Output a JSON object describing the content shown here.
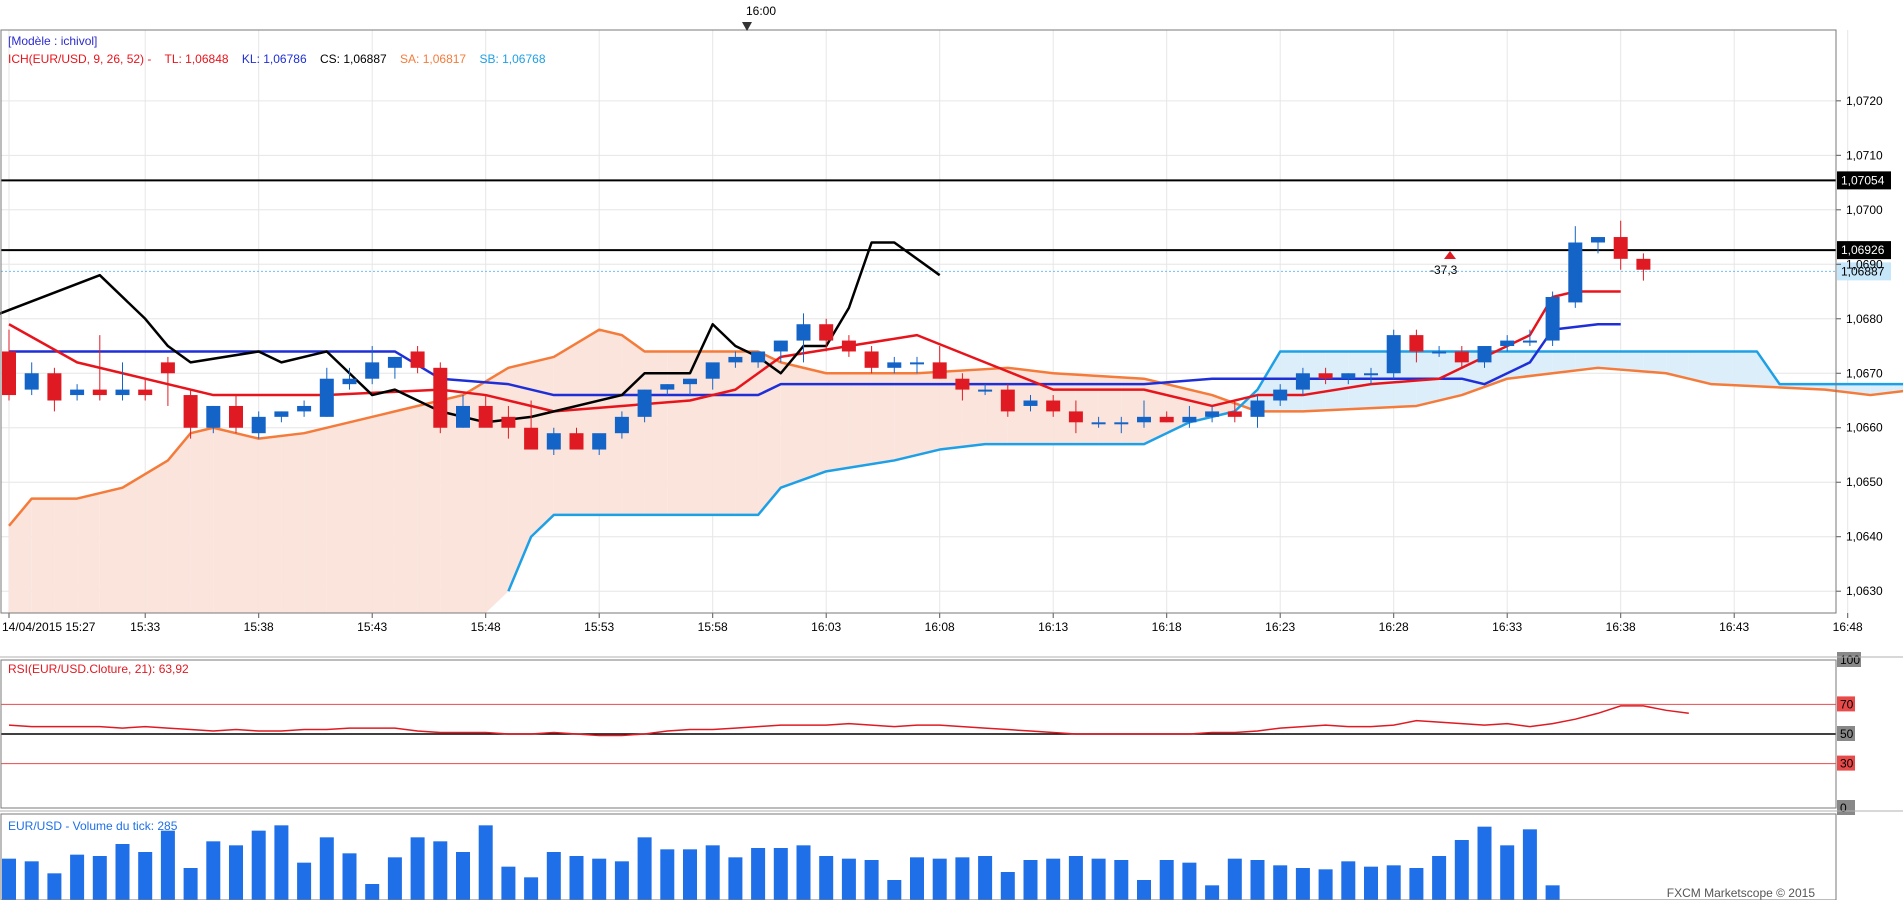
{
  "top_marker": "16:00",
  "model_label": "[Modèle : ichivol]",
  "ichimoku_legend": [
    {
      "text": "ICH(EUR/USD, 9, 26, 52) -",
      "color": "#e8141c"
    },
    {
      "text": "TL: 1,06848",
      "color": "#e8141c"
    },
    {
      "text": "KL: 1,06786",
      "color": "#1f2fd8"
    },
    {
      "text": "CS: 1,06887",
      "color": "#000000"
    },
    {
      "text": "SA: 1,06817",
      "color": "#f47b3a"
    },
    {
      "text": "SB: 1,06768",
      "color": "#1ea0e6"
    }
  ],
  "annotation": "-37,3",
  "rsi_label": "RSI(EUR/USD.Cloture, 21): 63,92",
  "volume_label": "EUR/USD - Volume du tick: 285",
  "footer": "FXCM Marketscope © 2015",
  "colors": {
    "bull": "#1464c8",
    "bear": "#e01a22",
    "tenkan": "#e8141c",
    "kijun": "#1f2fd8",
    "chikou": "#000000",
    "senkou_a": "#f47b3a",
    "senkou_b": "#1ea0e6",
    "cloud_bull": "#dceef9",
    "cloud_bear": "#fbe4dc",
    "volume": "#1e6fe8"
  },
  "chart_data": [
    {
      "type": "candlestick",
      "title": "ICH(EUR/USD, 9, 26, 52)",
      "ylim": [
        1.0626,
        1.0733
      ],
      "y_ticks": [
        "1,0630",
        "1,0640",
        "1,0650",
        "1,0660",
        "1,0670",
        "1,0680",
        "1,0690",
        "1,0700",
        "1,0710",
        "1,0720"
      ],
      "x_ticks": [
        "14/04/2015 15:27",
        "15:33",
        "15:38",
        "15:43",
        "15:48",
        "15:53",
        "15:58",
        "16:03",
        "16:08",
        "16:13",
        "16:18",
        "16:23",
        "16:28",
        "16:33",
        "16:38",
        "16:43",
        "16:48"
      ],
      "horizontal_lines": [
        {
          "value": 1.07054,
          "label": "1,07054"
        },
        {
          "value": 1.06926,
          "label": "1,06926"
        }
      ],
      "price_line": {
        "value": 1.06887,
        "label": "1,06887"
      },
      "candles": [
        [
          1.0674,
          1.0678,
          1.0665,
          1.0666
        ],
        [
          1.0667,
          1.0672,
          1.0666,
          1.067
        ],
        [
          1.067,
          1.0671,
          1.0663,
          1.0665
        ],
        [
          1.0666,
          1.0668,
          1.0665,
          1.0667
        ],
        [
          1.0667,
          1.0677,
          1.0665,
          1.0666
        ],
        [
          1.0666,
          1.0672,
          1.0665,
          1.0667
        ],
        [
          1.0667,
          1.0669,
          1.0665,
          1.0666
        ],
        [
          1.0672,
          1.0673,
          1.0664,
          1.067
        ],
        [
          1.0666,
          1.0667,
          1.0658,
          1.066
        ],
        [
          1.066,
          1.0664,
          1.0659,
          1.0664
        ],
        [
          1.0664,
          1.0666,
          1.0659,
          1.066
        ],
        [
          1.0659,
          1.0663,
          1.0658,
          1.0662
        ],
        [
          1.0662,
          1.0663,
          1.0661,
          1.0663
        ],
        [
          1.0663,
          1.0665,
          1.0662,
          1.0664
        ],
        [
          1.0662,
          1.0671,
          1.0662,
          1.0669
        ],
        [
          1.0668,
          1.0671,
          1.0667,
          1.0669
        ],
        [
          1.0669,
          1.0675,
          1.0668,
          1.0672
        ],
        [
          1.0671,
          1.0673,
          1.0669,
          1.0673
        ],
        [
          1.0674,
          1.0675,
          1.067,
          1.0671
        ],
        [
          1.0671,
          1.0672,
          1.0659,
          1.066
        ],
        [
          1.066,
          1.0666,
          1.066,
          1.0664
        ],
        [
          1.0664,
          1.0666,
          1.0661,
          1.066
        ],
        [
          1.0662,
          1.0664,
          1.0658,
          1.066
        ],
        [
          1.066,
          1.0665,
          1.0658,
          1.0656
        ],
        [
          1.0656,
          1.066,
          1.0655,
          1.0659
        ],
        [
          1.0659,
          1.066,
          1.0656,
          1.0656
        ],
        [
          1.0656,
          1.0657,
          1.0655,
          1.0659
        ],
        [
          1.0659,
          1.0663,
          1.0658,
          1.0662
        ],
        [
          1.0662,
          1.0667,
          1.0661,
          1.0667
        ],
        [
          1.0667,
          1.0668,
          1.0666,
          1.0668
        ],
        [
          1.0668,
          1.0669,
          1.0666,
          1.0669
        ],
        [
          1.0669,
          1.067,
          1.0667,
          1.0672
        ],
        [
          1.0672,
          1.0674,
          1.0671,
          1.0673
        ],
        [
          1.0672,
          1.0674,
          1.0671,
          1.0674
        ],
        [
          1.0674,
          1.0676,
          1.0672,
          1.0676
        ],
        [
          1.0676,
          1.0681,
          1.0672,
          1.0679
        ],
        [
          1.0679,
          1.068,
          1.0674,
          1.0676
        ],
        [
          1.0676,
          1.0677,
          1.0673,
          1.0674
        ],
        [
          1.0674,
          1.0675,
          1.067,
          1.0671
        ],
        [
          1.0671,
          1.0673,
          1.067,
          1.0672
        ],
        [
          1.0672,
          1.0673,
          1.067,
          1.0672
        ],
        [
          1.0672,
          1.0675,
          1.0669,
          1.0669
        ],
        [
          1.0669,
          1.067,
          1.0665,
          1.0667
        ],
        [
          1.0667,
          1.0668,
          1.0666,
          1.0667
        ],
        [
          1.0667,
          1.0668,
          1.0662,
          1.0663
        ],
        [
          1.0664,
          1.0666,
          1.0663,
          1.0665
        ],
        [
          1.0665,
          1.0666,
          1.0662,
          1.0663
        ],
        [
          1.0663,
          1.0665,
          1.0659,
          1.0661
        ],
        [
          1.0661,
          1.0662,
          1.066,
          1.0661
        ],
        [
          1.0661,
          1.0662,
          1.0659,
          1.0661
        ],
        [
          1.0661,
          1.0665,
          1.066,
          1.0662
        ],
        [
          1.0662,
          1.0663,
          1.0661,
          1.0661
        ],
        [
          1.0661,
          1.0664,
          1.066,
          1.0662
        ],
        [
          1.0662,
          1.0664,
          1.0661,
          1.0663
        ],
        [
          1.0663,
          1.0665,
          1.0661,
          1.0662
        ],
        [
          1.0662,
          1.0666,
          1.066,
          1.0665
        ],
        [
          1.0665,
          1.0668,
          1.0664,
          1.0667
        ],
        [
          1.0667,
          1.0671,
          1.0666,
          1.067
        ],
        [
          1.067,
          1.0671,
          1.0668,
          1.0669
        ],
        [
          1.0669,
          1.067,
          1.0668,
          1.067
        ],
        [
          1.067,
          1.0671,
          1.0668,
          1.067
        ],
        [
          1.067,
          1.0678,
          1.0669,
          1.0677
        ],
        [
          1.0677,
          1.0678,
          1.0672,
          1.0674
        ],
        [
          1.0674,
          1.0675,
          1.0673,
          1.0674
        ],
        [
          1.0674,
          1.0675,
          1.0671,
          1.0672
        ],
        [
          1.0672,
          1.0675,
          1.0671,
          1.0675
        ],
        [
          1.0675,
          1.0677,
          1.0674,
          1.0676
        ],
        [
          1.0676,
          1.0678,
          1.0675,
          1.0676
        ],
        [
          1.0676,
          1.0685,
          1.0675,
          1.0684
        ],
        [
          1.0683,
          1.0697,
          1.0682,
          1.0694
        ],
        [
          1.0694,
          1.0695,
          1.0692,
          1.0695
        ],
        [
          1.0695,
          1.0698,
          1.0689,
          1.0691
        ],
        [
          1.0691,
          1.0692,
          1.0687,
          1.0689
        ]
      ],
      "tenkan": [
        [
          0,
          1.0679
        ],
        [
          3,
          1.0672
        ],
        [
          6,
          1.0669
        ],
        [
          9,
          1.0666
        ],
        [
          14,
          1.0666
        ],
        [
          19,
          1.0667
        ],
        [
          21,
          1.0666
        ],
        [
          24,
          1.0663
        ],
        [
          27,
          1.0664
        ],
        [
          30,
          1.0665
        ],
        [
          32,
          1.0667
        ],
        [
          34,
          1.0673
        ],
        [
          37,
          1.0675
        ],
        [
          40,
          1.0677
        ],
        [
          43,
          1.0672
        ],
        [
          46,
          1.0667
        ],
        [
          50,
          1.0667
        ],
        [
          53,
          1.0664
        ],
        [
          55,
          1.0666
        ],
        [
          57,
          1.0666
        ],
        [
          60,
          1.0668
        ],
        [
          63,
          1.0669
        ],
        [
          65,
          1.0673
        ],
        [
          67,
          1.0677
        ],
        [
          68,
          1.0684
        ],
        [
          69,
          1.0685
        ],
        [
          71,
          1.0685
        ]
      ],
      "kijun": [
        [
          0,
          1.0674
        ],
        [
          10,
          1.0674
        ],
        [
          17,
          1.0674
        ],
        [
          19,
          1.0669
        ],
        [
          22,
          1.0668
        ],
        [
          24,
          1.0666
        ],
        [
          33,
          1.0666
        ],
        [
          34,
          1.0668
        ],
        [
          46,
          1.0668
        ],
        [
          50,
          1.0668
        ],
        [
          53,
          1.0669
        ],
        [
          64,
          1.0669
        ],
        [
          65,
          1.0668
        ],
        [
          67,
          1.0672
        ],
        [
          68,
          1.0678
        ],
        [
          70,
          1.0679
        ],
        [
          71,
          1.0679
        ]
      ],
      "chikou": [
        [
          -1,
          1.068
        ],
        [
          4,
          1.0688
        ],
        [
          6,
          1.068
        ],
        [
          7,
          1.0675
        ],
        [
          8,
          1.0672
        ],
        [
          11,
          1.0674
        ],
        [
          12,
          1.0672
        ],
        [
          14,
          1.0674
        ],
        [
          15,
          1.067
        ],
        [
          16,
          1.0666
        ],
        [
          17,
          1.0667
        ],
        [
          18,
          1.0665
        ],
        [
          19,
          1.0663
        ],
        [
          21,
          1.0661
        ],
        [
          23,
          1.0662
        ],
        [
          27,
          1.0666
        ],
        [
          28,
          1.067
        ],
        [
          30,
          1.067
        ],
        [
          31,
          1.0679
        ],
        [
          32,
          1.0675
        ],
        [
          33,
          1.0673
        ],
        [
          34,
          1.067
        ],
        [
          35,
          1.0675
        ],
        [
          36,
          1.0675
        ],
        [
          37,
          1.0682
        ],
        [
          38,
          1.0694
        ],
        [
          39,
          1.0694
        ],
        [
          41,
          1.0688
        ]
      ],
      "senkou_a": [
        [
          0,
          1.0642
        ],
        [
          1,
          1.0647
        ],
        [
          3,
          1.0647
        ],
        [
          5,
          1.0649
        ],
        [
          7,
          1.0654
        ],
        [
          8,
          1.0659
        ],
        [
          9,
          1.066
        ],
        [
          11,
          1.0658
        ],
        [
          13,
          1.0659
        ],
        [
          17,
          1.0663
        ],
        [
          20,
          1.0666
        ],
        [
          22,
          1.0671
        ],
        [
          24,
          1.0673
        ],
        [
          26,
          1.0678
        ],
        [
          27,
          1.0677
        ],
        [
          28,
          1.0674
        ],
        [
          30,
          1.0674
        ],
        [
          33,
          1.0674
        ],
        [
          34,
          1.0672
        ],
        [
          36,
          1.067
        ],
        [
          40,
          1.067
        ],
        [
          44,
          1.0671
        ],
        [
          46,
          1.067
        ],
        [
          50,
          1.0669
        ],
        [
          53,
          1.0666
        ],
        [
          55,
          1.0663
        ],
        [
          57,
          1.0663
        ],
        [
          62,
          1.0664
        ],
        [
          64,
          1.0666
        ],
        [
          66,
          1.0669
        ],
        [
          68,
          1.067
        ],
        [
          70,
          1.0671
        ],
        [
          73,
          1.067
        ],
        [
          74,
          1.0669
        ],
        [
          75,
          1.0668
        ],
        [
          80,
          1.0667
        ],
        [
          82,
          1.0666
        ],
        [
          84,
          1.0667
        ],
        [
          88,
          1.0667
        ],
        [
          89,
          1.0669
        ]
      ],
      "senkou_b": [
        [
          22,
          1.063
        ],
        [
          23,
          1.064
        ],
        [
          24,
          1.0644
        ],
        [
          33,
          1.0644
        ],
        [
          34,
          1.0649
        ],
        [
          36,
          1.0652
        ],
        [
          39,
          1.0654
        ],
        [
          41,
          1.0656
        ],
        [
          43,
          1.0657
        ],
        [
          50,
          1.0657
        ],
        [
          52,
          1.0661
        ],
        [
          54,
          1.0663
        ],
        [
          55,
          1.0667
        ],
        [
          56,
          1.0674
        ],
        [
          77,
          1.0674
        ],
        [
          78,
          1.0668
        ],
        [
          89,
          1.0668
        ]
      ],
      "cloud_start_index": 0
    },
    {
      "type": "line",
      "title": "RSI(EUR/USD.Cloture, 21)",
      "ylim": [
        0,
        100
      ],
      "y_ticks": [
        {
          "value": 100,
          "label": "100"
        },
        {
          "value": 70,
          "label": "70"
        },
        {
          "value": 50,
          "label": "50"
        },
        {
          "value": 30,
          "label": "30"
        },
        {
          "value": 0,
          "label": "0"
        }
      ],
      "levels": [
        70,
        50,
        30
      ],
      "values": [
        56,
        55,
        55,
        55,
        55,
        54,
        55,
        54,
        53,
        52,
        53,
        52,
        52,
        53,
        53,
        54,
        54,
        54,
        52,
        51,
        51,
        51,
        50,
        50,
        51,
        50,
        49,
        49,
        50,
        52,
        53,
        53,
        54,
        55,
        56,
        56,
        56,
        57,
        56,
        55,
        56,
        56,
        55,
        54,
        53,
        52,
        51,
        50,
        50,
        50,
        50,
        50,
        50,
        51,
        51,
        52,
        54,
        55,
        56,
        55,
        55,
        56,
        59,
        58,
        57,
        56,
        57,
        55,
        57,
        60,
        64,
        69,
        69,
        66,
        64
      ]
    },
    {
      "type": "bar",
      "title": "EUR/USD - Volume du tick",
      "value_label": "285",
      "values": [
        31,
        29,
        20,
        34,
        33,
        42,
        36,
        52,
        24,
        44,
        41,
        52,
        56,
        28,
        47,
        35,
        12,
        32,
        47,
        44,
        36,
        56,
        25,
        17,
        36,
        33,
        31,
        29,
        47,
        38,
        38,
        41,
        32,
        39,
        39,
        41,
        33,
        31,
        30,
        15,
        32,
        31,
        32,
        33,
        21,
        30,
        31,
        33,
        31,
        30,
        15,
        30,
        28,
        11,
        31,
        30,
        26,
        24,
        23,
        29,
        25,
        26,
        24,
        33,
        45,
        55,
        41,
        53,
        11
      ]
    }
  ]
}
